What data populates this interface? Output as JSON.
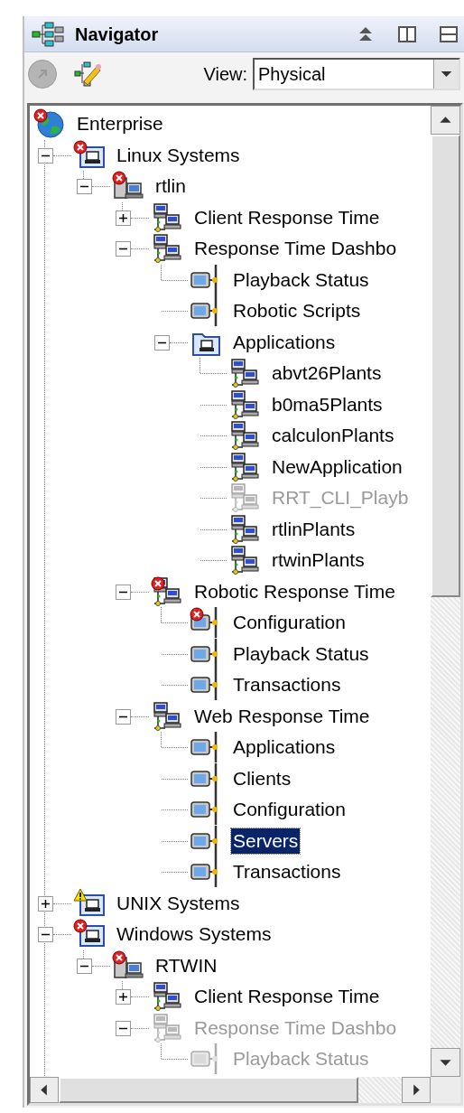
{
  "panel": {
    "title": "Navigator"
  },
  "toolbar": {
    "view_label": "View:",
    "view_value": "Physical"
  },
  "tree": [
    {
      "label": "Enterprise",
      "kind": "enterprise",
      "error": true,
      "warning": false,
      "disabled": false,
      "selected": false,
      "children": [
        {
          "label": "Linux Systems",
          "kind": "group",
          "error": true,
          "warning": false,
          "expanded": true,
          "disabled": false,
          "selected": false,
          "children": [
            {
              "label": "rtlin",
              "kind": "host",
              "error": true,
              "warning": false,
              "expanded": true,
              "disabled": false,
              "selected": false,
              "children": [
                {
                  "label": "Client Response Time",
                  "kind": "service",
                  "error": false,
                  "warning": false,
                  "expanded": false,
                  "disabled": false,
                  "selected": false
                },
                {
                  "label": "Response Time Dashbo",
                  "kind": "service",
                  "error": false,
                  "warning": false,
                  "expanded": true,
                  "disabled": false,
                  "selected": false,
                  "children": [
                    {
                      "label": "Playback Status",
                      "kind": "component",
                      "error": false,
                      "warning": false,
                      "disabled": false,
                      "selected": false
                    },
                    {
                      "label": "Robotic Scripts",
                      "kind": "component",
                      "error": false,
                      "warning": false,
                      "disabled": false,
                      "selected": false
                    },
                    {
                      "label": "Applications",
                      "kind": "folder",
                      "error": false,
                      "warning": false,
                      "expanded": true,
                      "disabled": false,
                      "selected": false,
                      "children": [
                        {
                          "label": "abvt26Plants",
                          "kind": "service",
                          "error": false,
                          "warning": false,
                          "disabled": false,
                          "selected": false
                        },
                        {
                          "label": "b0ma5Plants",
                          "kind": "service",
                          "error": false,
                          "warning": false,
                          "disabled": false,
                          "selected": false
                        },
                        {
                          "label": "calculonPlants",
                          "kind": "service",
                          "error": false,
                          "warning": false,
                          "disabled": false,
                          "selected": false
                        },
                        {
                          "label": "NewApplication",
                          "kind": "service",
                          "error": false,
                          "warning": false,
                          "disabled": false,
                          "selected": false
                        },
                        {
                          "label": "RRT_CLI_Playb",
                          "kind": "service",
                          "error": false,
                          "warning": false,
                          "disabled": true,
                          "selected": false
                        },
                        {
                          "label": "rtlinPlants",
                          "kind": "service",
                          "error": false,
                          "warning": false,
                          "disabled": false,
                          "selected": false
                        },
                        {
                          "label": "rtwinPlants",
                          "kind": "service",
                          "error": false,
                          "warning": false,
                          "disabled": false,
                          "selected": false
                        }
                      ]
                    }
                  ]
                },
                {
                  "label": "Robotic Response Time",
                  "kind": "service",
                  "error": true,
                  "warning": false,
                  "expanded": true,
                  "disabled": false,
                  "selected": false,
                  "children": [
                    {
                      "label": "Configuration",
                      "kind": "component",
                      "error": true,
                      "warning": false,
                      "disabled": false,
                      "selected": false
                    },
                    {
                      "label": "Playback Status",
                      "kind": "component",
                      "error": false,
                      "warning": false,
                      "disabled": false,
                      "selected": false
                    },
                    {
                      "label": "Transactions",
                      "kind": "component",
                      "error": false,
                      "warning": false,
                      "disabled": false,
                      "selected": false
                    }
                  ]
                },
                {
                  "label": "Web Response Time",
                  "kind": "service",
                  "error": false,
                  "warning": false,
                  "expanded": true,
                  "disabled": false,
                  "selected": false,
                  "children": [
                    {
                      "label": "Applications",
                      "kind": "component",
                      "error": false,
                      "warning": false,
                      "disabled": false,
                      "selected": false
                    },
                    {
                      "label": "Clients",
                      "kind": "component",
                      "error": false,
                      "warning": false,
                      "disabled": false,
                      "selected": false
                    },
                    {
                      "label": "Configuration",
                      "kind": "component",
                      "error": false,
                      "warning": false,
                      "disabled": false,
                      "selected": false
                    },
                    {
                      "label": "Servers",
                      "kind": "component",
                      "error": false,
                      "warning": false,
                      "disabled": false,
                      "selected": true
                    },
                    {
                      "label": "Transactions",
                      "kind": "component",
                      "error": false,
                      "warning": false,
                      "disabled": false,
                      "selected": false
                    }
                  ]
                }
              ]
            }
          ]
        },
        {
          "label": "UNIX Systems",
          "kind": "group",
          "error": false,
          "warning": true,
          "expanded": false,
          "disabled": false,
          "selected": false
        },
        {
          "label": "Windows Systems",
          "kind": "group",
          "error": true,
          "warning": false,
          "expanded": true,
          "disabled": false,
          "selected": false,
          "children": [
            {
              "label": "RTWIN",
              "kind": "host",
              "error": true,
              "warning": false,
              "expanded": true,
              "disabled": false,
              "selected": false,
              "children": [
                {
                  "label": "Client Response Time",
                  "kind": "service",
                  "error": false,
                  "warning": false,
                  "expanded": false,
                  "disabled": false,
                  "selected": false
                },
                {
                  "label": "Response Time Dashbo",
                  "kind": "service",
                  "error": false,
                  "warning": false,
                  "expanded": true,
                  "disabled": true,
                  "selected": false,
                  "children": [
                    {
                      "label": "Playback Status",
                      "kind": "component",
                      "error": false,
                      "warning": false,
                      "disabled": true,
                      "selected": false
                    }
                  ]
                }
              ]
            }
          ]
        }
      ]
    }
  ]
}
